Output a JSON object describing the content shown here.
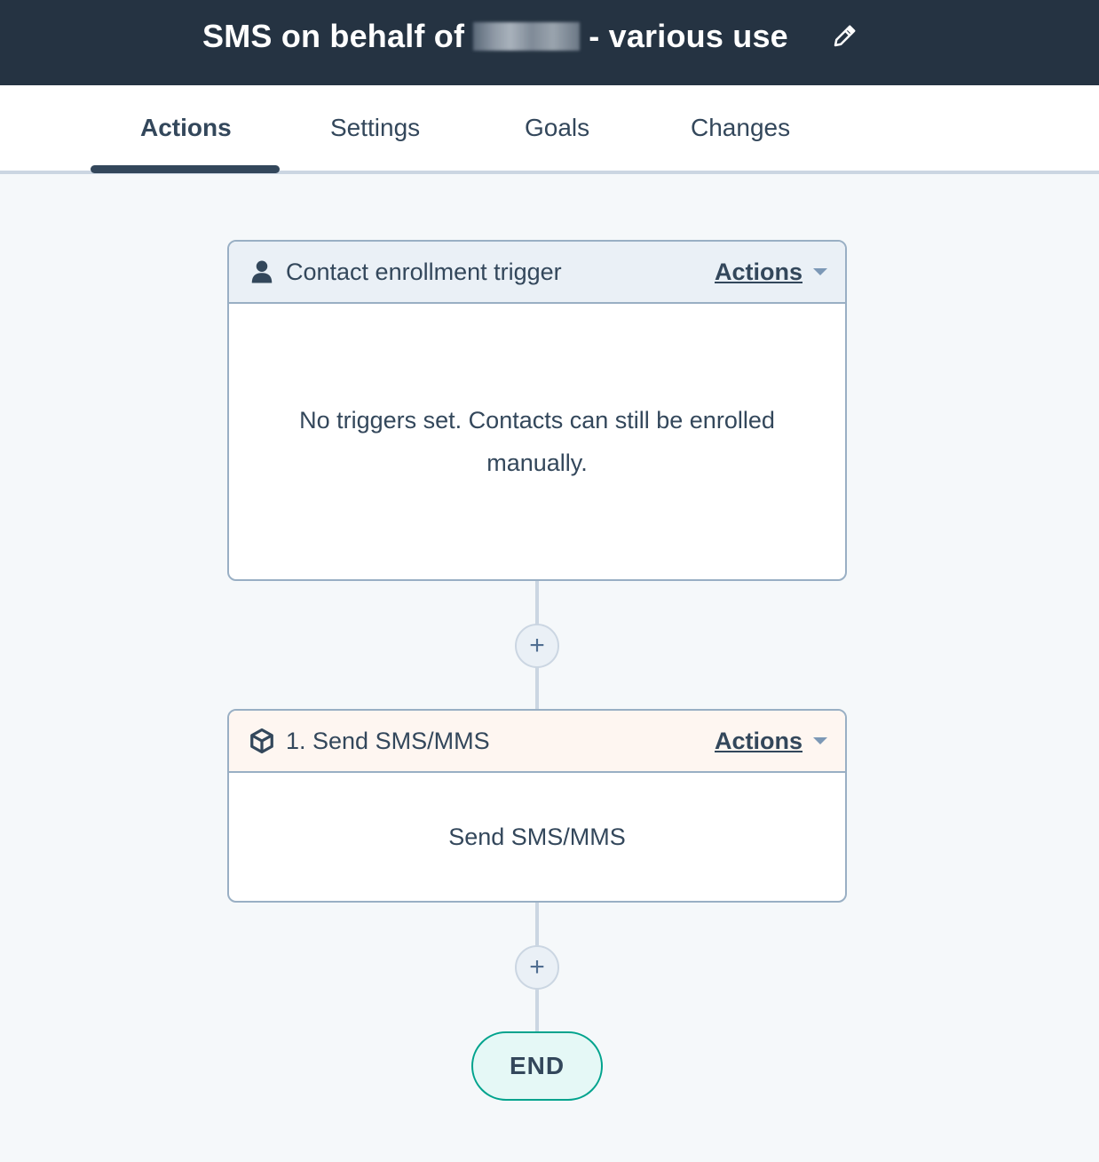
{
  "header": {
    "title_prefix": "SMS on behalf of",
    "title_suffix": "- various use",
    "edit_icon": "pencil-icon"
  },
  "tabs": [
    {
      "label": "Actions",
      "active": true
    },
    {
      "label": "Settings",
      "active": false
    },
    {
      "label": "Goals",
      "active": false
    },
    {
      "label": "Changes",
      "active": false
    }
  ],
  "trigger_card": {
    "icon": "contact-icon",
    "title": "Contact enrollment trigger",
    "actions_label": "Actions",
    "body_line1": "No triggers set. Contacts can still be enrolled",
    "body_line2": "manually.",
    "header_bg": "#eaf0f6"
  },
  "action_card": {
    "icon": "cube-icon",
    "title": "1. Send SMS/MMS",
    "actions_label": "Actions",
    "body": "Send SMS/MMS",
    "header_bg": "#fef6f1"
  },
  "add_button_label": "+",
  "end_label": "END"
}
